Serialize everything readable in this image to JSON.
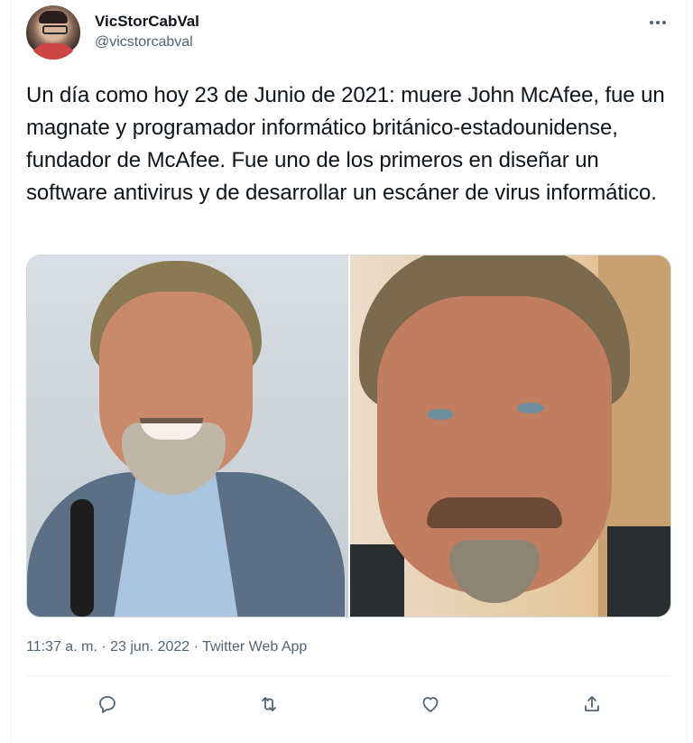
{
  "user": {
    "display_name": "VicStorCabVal",
    "handle": "@vicstorcabval"
  },
  "tweet": {
    "text": "Un día como hoy 23 de Junio de 2021: muere John McAfee, fue un magnate y programador informático británico-estadounidense, fundador de McAfee. Fue uno de los primeros en diseñar un software antivirus y de desarrollar un escáner de virus informático.",
    "time": "11:37 a. m.",
    "date": "23 jun. 2022",
    "source": "Twitter Web App",
    "separator": "·"
  },
  "icons": {
    "more": "more-horizontal-icon",
    "reply": "reply-icon",
    "retweet": "retweet-icon",
    "like": "like-icon",
    "share": "share-icon"
  },
  "colors": {
    "text": "#0f1419",
    "secondary": "#536471",
    "border": "#eff3f4"
  }
}
